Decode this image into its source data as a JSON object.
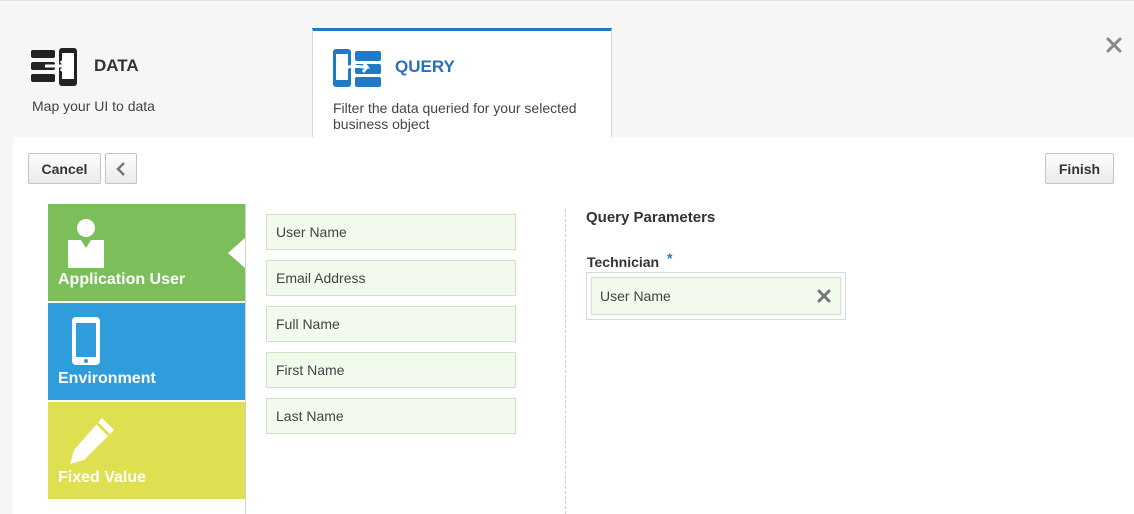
{
  "wizard": {
    "steps": [
      {
        "title": "DATA",
        "description": "Map your UI to data",
        "icon": "data-mapping-icon"
      },
      {
        "title": "QUERY",
        "description": "Filter the data queried for your selected business object",
        "icon": "query-filter-icon"
      }
    ],
    "close_icon": "close-icon"
  },
  "toolbar": {
    "cancel_label": "Cancel",
    "back_icon": "chevron-left-icon",
    "finish_label": "Finish"
  },
  "sources": [
    {
      "label": "Application User",
      "icon": "user-icon",
      "color": "#7cbe5a"
    },
    {
      "label": "Environment",
      "icon": "mobile-device-icon",
      "color": "#2f9ddb"
    },
    {
      "label": "Fixed Value",
      "icon": "pencil-icon",
      "color": "#dfdf52"
    }
  ],
  "fields": [
    "User Name",
    "Email Address",
    "Full Name",
    "First Name",
    "Last Name"
  ],
  "query_parameters": {
    "title": "Query Parameters",
    "parameter_label": "Technician",
    "required_marker": "*",
    "value": "User Name",
    "remove_icon": "remove-icon"
  },
  "colors": {
    "accent": "#1f7ac7",
    "field_bg": "#f2faee"
  }
}
